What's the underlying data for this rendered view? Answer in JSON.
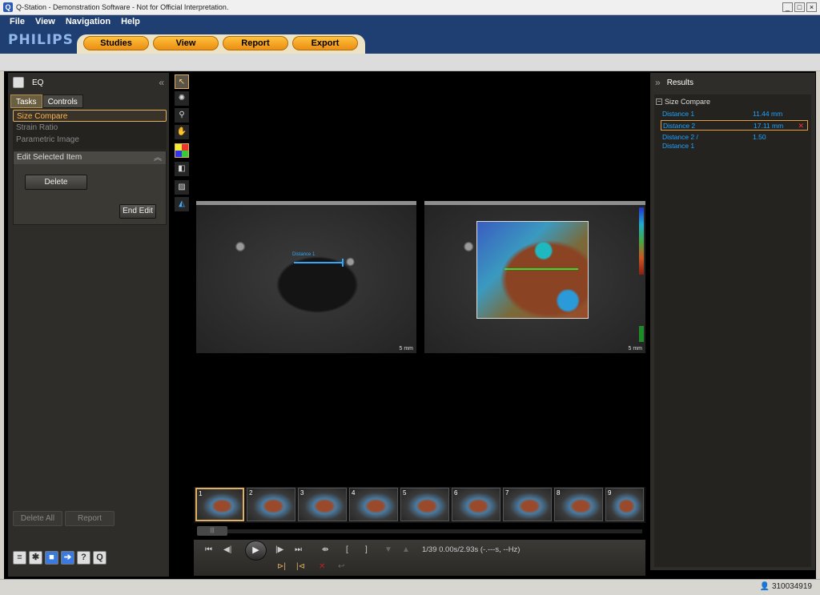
{
  "window": {
    "title": "Q-Station - Demonstration Software - Not for Official Interpretation.",
    "app_icon": "Q",
    "controls": [
      "_",
      "□",
      "×"
    ]
  },
  "menu": {
    "items": [
      "File",
      "View",
      "Navigation",
      "Help"
    ]
  },
  "brand": {
    "logo": "PHILIPS",
    "color": "#8fb6ea"
  },
  "nav": {
    "tabs": [
      "Studies",
      "View",
      "Report",
      "Export"
    ]
  },
  "left_panel": {
    "title": "EQ",
    "tabs": [
      "Tasks",
      "Controls"
    ],
    "tasks": [
      "Size Compare",
      "Strain Ratio",
      "Parametric Image"
    ],
    "edit_section": "Edit Selected Item",
    "delete_label": "Delete",
    "end_edit_label": "End Edit",
    "delete_all_label": "Delete All",
    "report_label": "Report",
    "bottom_icons": [
      "layers-icon",
      "settings-icon",
      "save-icon",
      "exit-icon",
      "help-icon",
      "q-icon"
    ]
  },
  "toolbar": {
    "tools": [
      "select-arrow-icon",
      "brightness-icon",
      "zoom-icon",
      "pan-hand-icon",
      "color-map-icon",
      "invert-icon",
      "grayscale-icon",
      "measure-icon"
    ]
  },
  "viewport": {
    "left_scale": "5 mm",
    "right_scale": "5 mm",
    "measure_label": "Distance 1",
    "measure_color": "#2ca8ff",
    "measure2_color": "#2fe030"
  },
  "results": {
    "title": "Results",
    "group": "Size Compare",
    "rows": [
      {
        "label": "Distance 1",
        "value": "11.44 mm"
      },
      {
        "label": "Distance 2",
        "value": "17.11 mm"
      },
      {
        "label": "Distance 2 /",
        "label2": "Distance 1",
        "value": "1.50"
      }
    ],
    "value_color": "#1ea4ff"
  },
  "thumbnails": [
    "1",
    "2",
    "3",
    "4",
    "5",
    "6",
    "7",
    "8",
    "9"
  ],
  "playback": {
    "frame_info": "1/39  0.00s/2.93s (-.---s, --Hz)",
    "scrub_handle": "|||"
  },
  "status": {
    "user_id": "310034919"
  }
}
